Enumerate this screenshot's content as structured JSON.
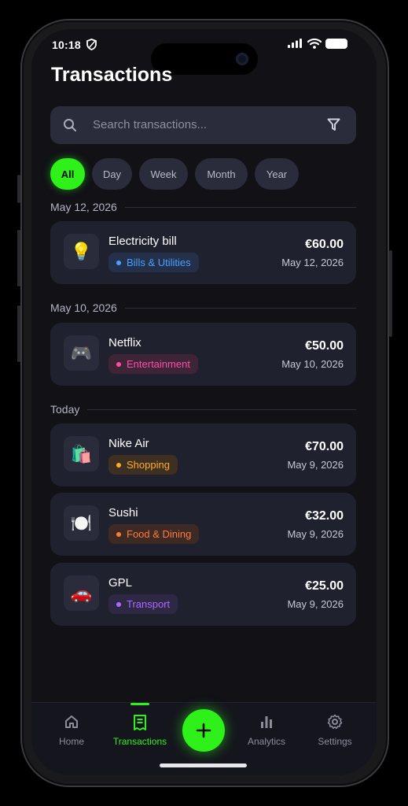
{
  "status": {
    "time": "10:18"
  },
  "header": {
    "title": "Transactions"
  },
  "search": {
    "placeholder": "Search transactions..."
  },
  "filters": [
    "All",
    "Day",
    "Week",
    "Month",
    "Year"
  ],
  "active_filter": "All",
  "groups": [
    {
      "date": "May 12, 2026",
      "items": [
        {
          "icon": "lightbulb-icon",
          "emoji": "💡",
          "name": "Electricity bill",
          "category": "Bills & Utilities",
          "category_color": "#4aa0ff",
          "category_bg": "#24304a",
          "amount": "€60.00",
          "date": "May 12, 2026"
        }
      ]
    },
    {
      "date": "May 10, 2026",
      "items": [
        {
          "icon": "game-controller-icon",
          "emoji": "🎮",
          "name": "Netflix",
          "category": "Entertainment",
          "category_color": "#ff4fa3",
          "category_bg": "#3d2436",
          "amount": "€50.00",
          "date": "May 10, 2026"
        }
      ]
    },
    {
      "date": "Today",
      "items": [
        {
          "icon": "shopping-bags-icon",
          "emoji": "🛍️",
          "name": "Nike Air",
          "category": "Shopping",
          "category_color": "#ffab2e",
          "category_bg": "#3d3022",
          "amount": "€70.00",
          "date": "May 9, 2026"
        },
        {
          "icon": "plate-cutlery-icon",
          "emoji": "🍽️",
          "name": "Sushi",
          "category": "Food & Dining",
          "category_color": "#ff7a3d",
          "category_bg": "#3d2a24",
          "amount": "€32.00",
          "date": "May 9, 2026"
        },
        {
          "icon": "car-icon",
          "emoji": "🚗",
          "name": "GPL",
          "category": "Transport",
          "category_color": "#a76bff",
          "category_bg": "#2f2845",
          "amount": "€25.00",
          "date": "May 9, 2026"
        }
      ]
    }
  ],
  "nav": {
    "home": "Home",
    "transactions": "Transactions",
    "analytics": "Analytics",
    "settings": "Settings"
  },
  "colors": {
    "accent": "#2ef11a",
    "background": "#111116",
    "card": "#20212e"
  }
}
